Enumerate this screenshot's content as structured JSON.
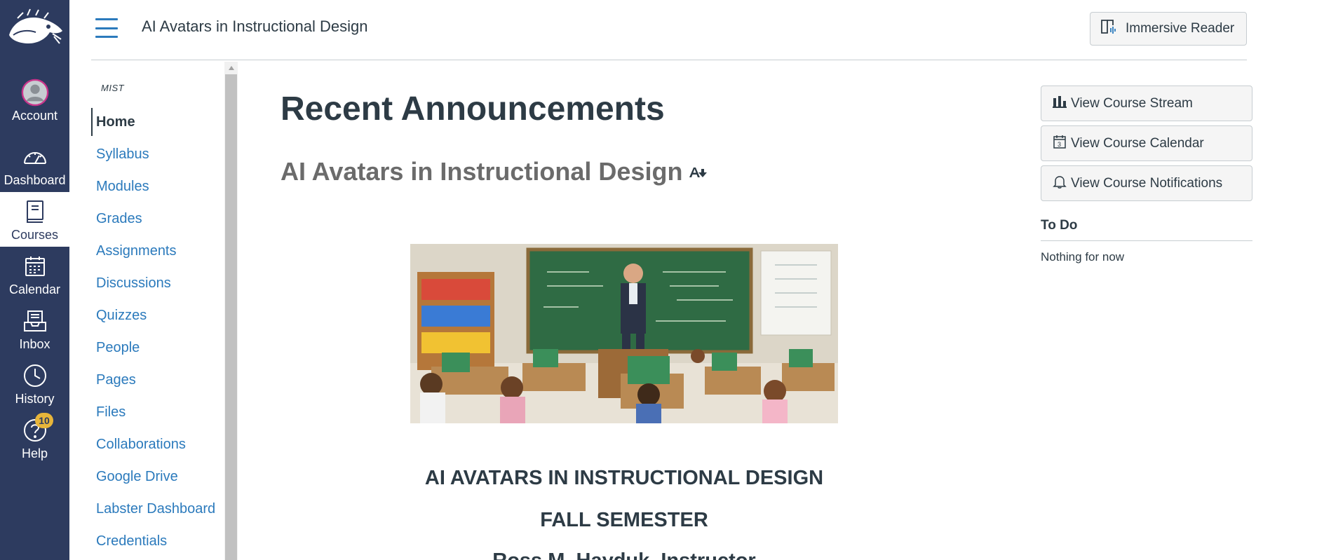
{
  "global_nav": {
    "items": [
      {
        "label": "Account",
        "icon": "avatar-icon"
      },
      {
        "label": "Dashboard",
        "icon": "dashboard-icon"
      },
      {
        "label": "Courses",
        "icon": "book-icon"
      },
      {
        "label": "Calendar",
        "icon": "calendar-icon"
      },
      {
        "label": "Inbox",
        "icon": "inbox-icon"
      },
      {
        "label": "History",
        "icon": "clock-icon"
      },
      {
        "label": "Help",
        "icon": "help-icon",
        "badge": "10"
      }
    ],
    "active": "Courses"
  },
  "header": {
    "breadcrumb": "AI Avatars in Instructional Design",
    "immersive_reader": "Immersive Reader"
  },
  "course_nav": {
    "course_code": "MIST",
    "items": [
      {
        "label": "Home"
      },
      {
        "label": "Syllabus"
      },
      {
        "label": "Modules"
      },
      {
        "label": "Grades"
      },
      {
        "label": "Assignments"
      },
      {
        "label": "Discussions"
      },
      {
        "label": "Quizzes"
      },
      {
        "label": "People"
      },
      {
        "label": "Pages"
      },
      {
        "label": "Files"
      },
      {
        "label": "Collaborations"
      },
      {
        "label": "Google Drive"
      },
      {
        "label": "Labster Dashboard"
      },
      {
        "label": "Credentials"
      }
    ],
    "active": "Home"
  },
  "main": {
    "announcements_heading": "Recent Announcements",
    "course_heading": "AI Avatars in Instructional Design",
    "caption_line1": "AI AVATARS IN INSTRUCTIONAL DESIGN",
    "caption_line2": "FALL SEMESTER",
    "caption_line3": "Ross M. Hayduk, Instructor"
  },
  "sidebar": {
    "buttons": [
      {
        "label": "View Course Stream",
        "icon": "bar-chart-icon"
      },
      {
        "label": "View Course Calendar",
        "icon": "calendar-icon"
      },
      {
        "label": "View Course Notifications",
        "icon": "bell-icon"
      }
    ],
    "todo_heading": "To Do",
    "todo_empty": "Nothing for now"
  },
  "colors": {
    "nav_bg": "#2d3b5f",
    "link": "#2b7abc",
    "text": "#2d3b45",
    "badge": "#e7b53a"
  }
}
